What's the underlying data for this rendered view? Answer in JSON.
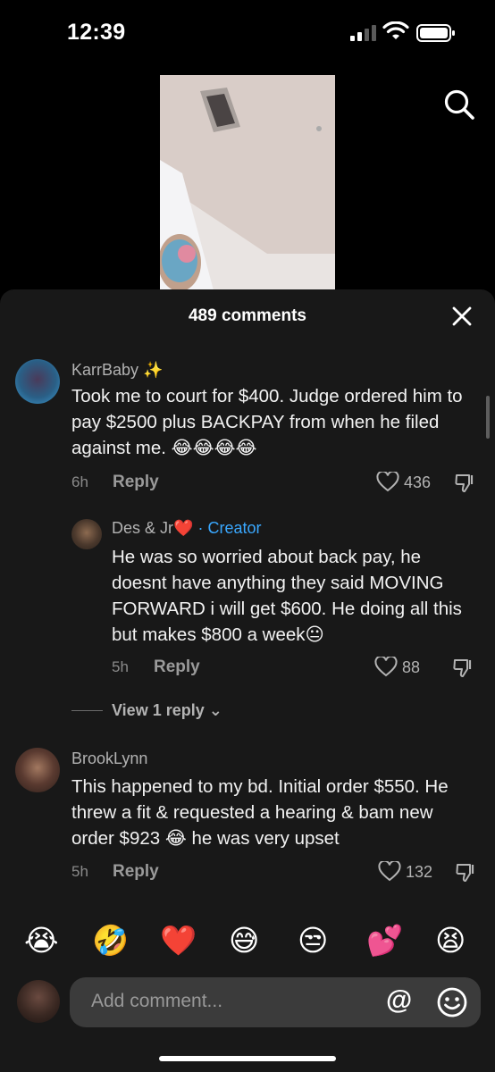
{
  "status": {
    "time": "12:39"
  },
  "comments_header": {
    "count_label": "489 comments"
  },
  "comments": [
    {
      "username": "KarrBaby",
      "username_suffix": "✨",
      "text": "Took me to court for $400. Judge ordered him to pay $2500 plus BACKPAY from when he filed against me. 😂😂😂😂",
      "time": "6h",
      "reply_label": "Reply",
      "likes": "436"
    },
    {
      "username": "Des & Jr",
      "username_suffix": "❤️",
      "creator_label": "· Creator",
      "text": "He was so worried about back pay, he doesnt have anything they said MOVING FORWARD i will get $600. He doing all this but makes $800 a week😐",
      "time": "5h",
      "reply_label": "Reply",
      "likes": "88"
    },
    {
      "username": "BrookLynn",
      "text": "This happened to my bd. Initial order $550. He threw a fit & requested a hearing & bam new order $923 😂 he was very upset",
      "time": "5h",
      "reply_label": "Reply",
      "likes": "132"
    }
  ],
  "view_replies": {
    "label": "View 1 reply",
    "chevron": "⌄"
  },
  "emoji_bar": [
    "😭",
    "🤣",
    "❤️",
    "😅",
    "😒",
    "💕",
    "😫"
  ],
  "composer": {
    "placeholder": "Add comment...",
    "mention": "@"
  },
  "colors": {
    "sheet": "#181818",
    "creator": "#3aa8ff",
    "input": "#3b3b3b"
  }
}
